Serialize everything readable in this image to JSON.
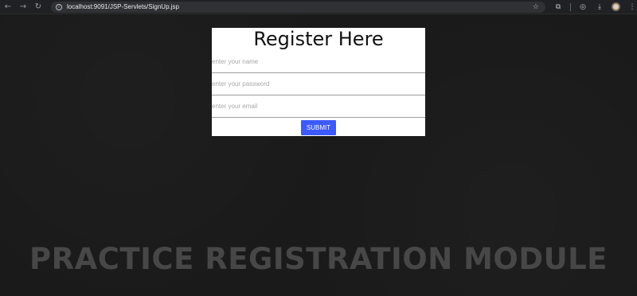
{
  "browser": {
    "url": "localhost:9091/JSP-Servlets/SignUp.jsp"
  },
  "form": {
    "title": "Register Here",
    "name_placeholder": "enter your name",
    "password_placeholder": "enter your password",
    "email_placeholder": "enter your email",
    "submit_label": "SUBMIT"
  },
  "background_text": "PRACTICE REGISTRATION MODULE",
  "colors": {
    "accent": "#3d5afe",
    "page_background": "#1a1a1a",
    "card_background": "#ffffff"
  }
}
